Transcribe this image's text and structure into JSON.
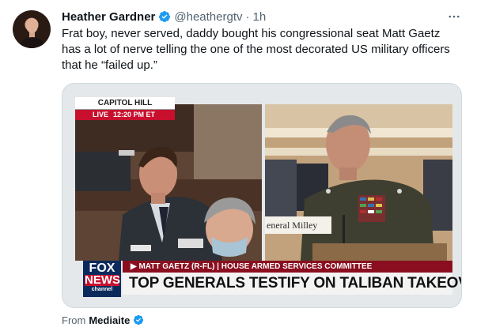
{
  "tweet": {
    "author_name": "Heather Gardner",
    "handle": "@heathergtv",
    "separator": "·",
    "time": "1h",
    "more_icon": "more-horizontal-icon",
    "text_lines": [
      "Frat boy, never served, daddy bought his congressional seat Matt Gaetz",
      "has a lot of nerve telling the one of the most decorated US military officers",
      "that he “failed up.”"
    ]
  },
  "media": {
    "capitol_label": "CAPITOL HILL",
    "live_label": "LIVE",
    "live_time": "12:20 PM ET",
    "lower_third": "▶ MATT GAETZ (R-FL) | HOUSE ARMED SERVICES COMMITTEE",
    "headline": "TOP GENERALS TESTIFY ON TALIBAN TAKEOVER",
    "nameplate": "eneral Milley",
    "logo_lines": [
      "FOX",
      "NEWS",
      "channel"
    ]
  },
  "from": {
    "label": "From",
    "source": "Mediaite"
  },
  "colors": {
    "verified_blue": "#1d9bf0",
    "secondary_text": "#536471",
    "fox_red": "#c8102e",
    "fox_blue": "#0b2a5c"
  }
}
